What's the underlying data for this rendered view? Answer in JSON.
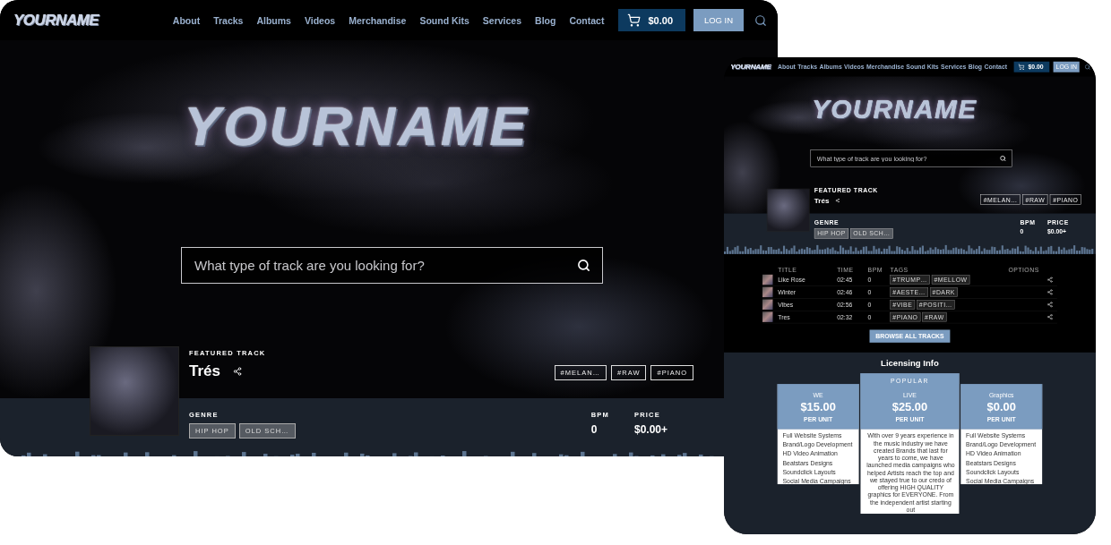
{
  "screens": [
    {
      "kind": "desktop",
      "nav": {
        "logo": "YOURNAME",
        "links": [
          "About",
          "Tracks",
          "Albums",
          "Videos",
          "Merchandise",
          "Sound Kits",
          "Services",
          "Blog",
          "Contact"
        ],
        "cart": "$0.00",
        "login": "LOG IN"
      },
      "hero": {
        "logo": "YOURNAME",
        "search": {
          "placeholder": "What type of track are you looking for?"
        }
      },
      "featured": {
        "label": "FEATURED TRACK",
        "title": "Trés",
        "tags": [
          "#MELAN…",
          "#RAW",
          "#PIANO"
        ],
        "genre_label": "GENRE",
        "genres": [
          "HIP HOP",
          "OLD SCH…"
        ],
        "bpm_label": "BPM",
        "bpm": "0",
        "price_label": "PRICE",
        "price": "$0.00+"
      }
    },
    {
      "kind": "tablet",
      "nav": {
        "logo": "YOURNAME",
        "links": [
          "About",
          "Tracks",
          "Albums",
          "Videos",
          "Merchandise",
          "Sound Kits",
          "Services",
          "Blog",
          "Contact"
        ],
        "cart": "$0.00",
        "login": "LOG IN"
      },
      "hero": {
        "logo": "YOURNAME",
        "search": {
          "placeholder": "What type of track are you looking for?"
        }
      },
      "featured": {
        "label": "FEATURED TRACK",
        "title": "Trés",
        "tags": [
          "#MELAN…",
          "#RAW",
          "#PIANO"
        ],
        "genre_label": "GENRE",
        "genres": [
          "HIP HOP",
          "OLD SCH…"
        ],
        "bpm_label": "BPM",
        "bpm": "0",
        "price_label": "PRICE",
        "price": "$0.00+"
      },
      "tracks": {
        "columns": [
          "TITLE",
          "TIME",
          "BPM",
          "TAGS",
          "OPTIONS"
        ],
        "rows": [
          {
            "title": "Like Rose",
            "time": "02:45",
            "bpm": "0",
            "tags": [
              "#TRUMP…",
              "#MELLOW"
            ]
          },
          {
            "title": "Winter",
            "time": "02:46",
            "bpm": "0",
            "tags": [
              "#AESTE…",
              "#DARK"
            ]
          },
          {
            "title": "Vibes",
            "time": "02:56",
            "bpm": "0",
            "tags": [
              "#VIBE",
              "#POSITI…"
            ]
          },
          {
            "title": "Tres",
            "time": "02:32",
            "bpm": "0",
            "tags": [
              "#PIANO",
              "#RAW"
            ]
          }
        ],
        "browse": "BROWSE ALL TRACKS"
      },
      "licensing": {
        "title": "Licensing Info",
        "cards": [
          {
            "name": "WE",
            "popular": false,
            "price": "$15.00",
            "unit": "PER UNIT",
            "features": [
              "Full Website Systems",
              "Brand/Logo Development",
              "HD Video Animation",
              "Beatstars Designs",
              "Soundclick Layouts",
              "Social Media Campaigns"
            ]
          },
          {
            "name": "LIVE",
            "popular": true,
            "badge": "POPULAR",
            "price": "$25.00",
            "unit": "PER UNIT",
            "description": "With over 9 years experience in the music industry we have created Brands that last for years to come, we have launched media campaigns who helped Artists reach the top and we stayed true to our credo of offering HIGH QUALITY graphics for EVERYONE. From the independent artist starting out"
          },
          {
            "name": "Graphics",
            "popular": false,
            "price": "$0.00",
            "unit": "PER UNIT",
            "features": [
              "Full Website Systems",
              "Brand/Logo Development",
              "HD Video Animation",
              "Beatstars Designs",
              "Soundclick Layouts",
              "Social Media Campaigns"
            ]
          }
        ]
      }
    }
  ]
}
